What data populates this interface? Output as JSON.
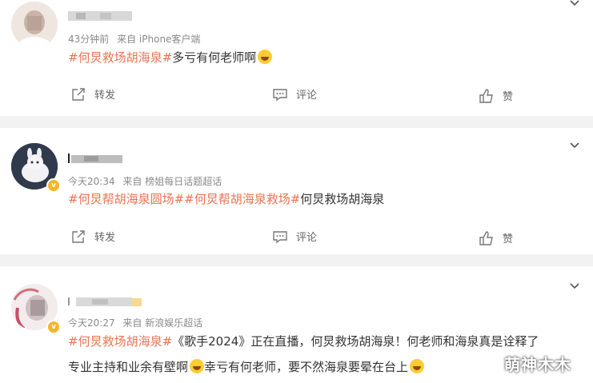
{
  "posts": [
    {
      "meta": {
        "time": "43分钟前",
        "source": "来自 iPhone客户端"
      },
      "segments": {
        "tag1": "#何炅救场胡海泉#",
        "body": "多亏有何老师啊"
      },
      "actions": {
        "repost": "转发",
        "comment": "评论",
        "like": "赞"
      }
    },
    {
      "meta": {
        "time": "今天20:34",
        "source": "来自 榜姐每日话题超话"
      },
      "segments": {
        "tag1": "#何炅帮胡海泉圆场#",
        "tag2": "#何炅帮胡海泉救场#",
        "body": "何炅救场胡海泉"
      },
      "actions": {
        "repost": "转发",
        "comment": "评论",
        "like": "赞"
      }
    },
    {
      "meta": {
        "time": "今天20:27",
        "source": "来自 新浪娱乐超话"
      },
      "segments": {
        "tag1": "#何炅救场胡海泉#",
        "line1": "《歌手2024》正在直播，何炅救场胡海泉！何老师和海泉真是诠释了",
        "line2a": "专业主持和业余有壁啊",
        "line2b": "幸亏有何老师，要不然海泉要晕在台上"
      }
    }
  ],
  "watermark": "萌神木木",
  "colors": {
    "tag": "#eb7350",
    "meta": "#8a8a8a",
    "separator": "#f2f2f2",
    "badge": "#f5b52a"
  },
  "icons": [
    "repost-icon",
    "comment-icon",
    "like-icon",
    "chevron-down-icon",
    "vip-badge-icon",
    "laugh-emoji-icon"
  ]
}
